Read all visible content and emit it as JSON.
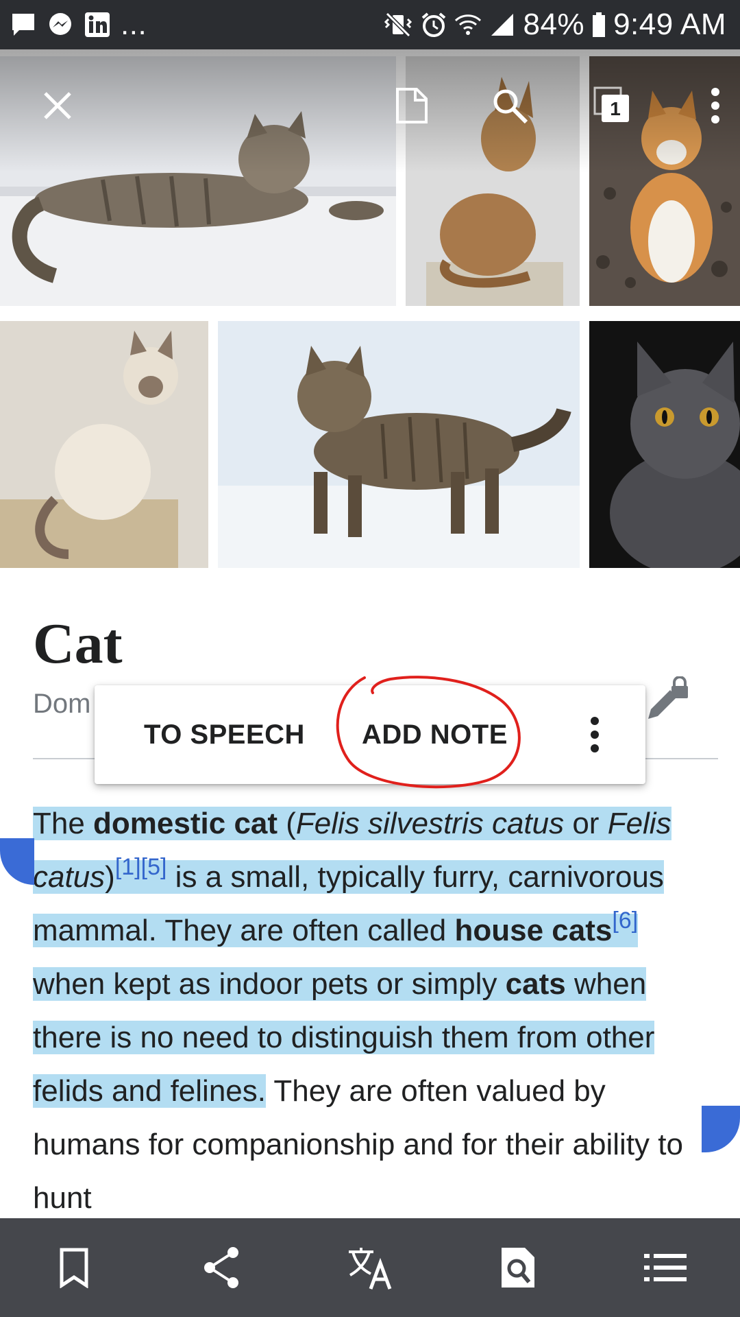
{
  "status_bar": {
    "notifications": [
      "message-icon",
      "messenger-icon",
      "linkedin-icon"
    ],
    "more": "...",
    "battery": "84%",
    "time": "9:49 AM"
  },
  "gallery": {
    "tab_count": "1",
    "photos": [
      "tabby-cat-lying",
      "abyssinian-cat-sitting",
      "orange-white-cat",
      "siamese-cat",
      "tabby-cat-in-snow",
      "grey-cat"
    ]
  },
  "article": {
    "title": "Cat",
    "description": "Dom",
    "body": {
      "p1_the": "The ",
      "p1_domestic_cat": "domestic cat",
      "p1_open": " (",
      "p1_fsc": "Felis silvestris catus",
      "p1_or": " or ",
      "p1_felis": "Felis",
      "p1_sp": " ",
      "p1_catus": "catus",
      "p1_close": ")",
      "ref_1_5": "[1][5]",
      "p1_rest": " is a small, typically furry, carnivorous mammal. They are often called ",
      "p1_house_cats": "house cats",
      "ref_6": "[6]",
      "p1_when": " when kept as indoor pets or simply ",
      "p1_cats": "cats",
      "p1_end": " when there is no need to distinguish them from other felids and felines.",
      "p2": " They are often valued by humans for companionship and for their ability to hunt"
    }
  },
  "context_menu": {
    "to_speech": "TO SPEECH",
    "add_note": "ADD NOTE"
  },
  "colors": {
    "selection": "#b3ddf2",
    "handle": "#3a6bd6",
    "annotation": "#e0201c",
    "bottom_bar": "#45474c",
    "link": "#3366cc"
  },
  "bottom_bar": {
    "buttons": [
      "bookmark-icon",
      "share-icon",
      "translate-icon",
      "find-in-page-icon",
      "table-of-contents-icon"
    ]
  }
}
